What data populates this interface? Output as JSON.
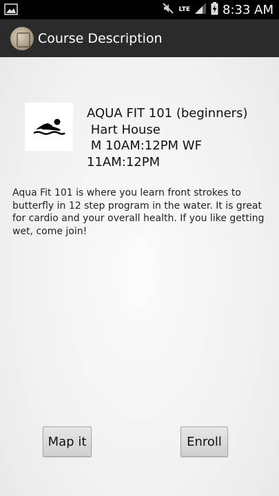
{
  "status_bar": {
    "time": "8:33 AM",
    "network": "LTE",
    "icons": [
      "gallery-icon",
      "mute-icon",
      "signal-icon",
      "battery-charging-icon"
    ]
  },
  "action_bar": {
    "title": "Course Description",
    "icon": "app-logo-icon"
  },
  "course": {
    "image_icon": "swimmer-icon",
    "info": "AQUA FIT 101 (beginners)\n Hart House\n M 10AM:12PM WF\n11AM:12PM",
    "description": "Aqua Fit 101 is where you learn front strokes to butterfly in 12 step program in the water. It is great for cardio and your overall health. If you like getting wet, come join!"
  },
  "buttons": {
    "map_label": "Map it",
    "enroll_label": "Enroll"
  }
}
